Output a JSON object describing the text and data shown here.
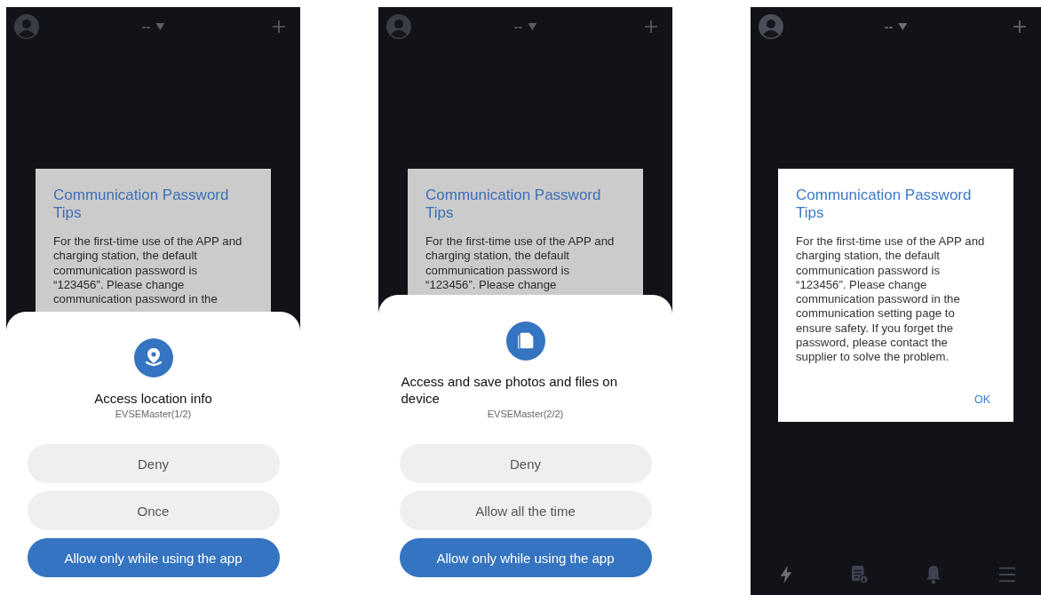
{
  "screens": [
    {
      "dimmed": true,
      "header": {
        "title": "--"
      },
      "dialog": {
        "title": "Communication Password Tips",
        "body_lines": [
          "For the first-time use of the APP and",
          "charging station, the default",
          "communication password is",
          "“123456”. Please change",
          "communication password in the"
        ]
      },
      "permission_sheet": {
        "kind": "location",
        "title": "Access location info",
        "subtitle": "EVSEMaster(1/2)",
        "buttons": [
          {
            "label": "Deny",
            "kind": "secondary"
          },
          {
            "label": "Once",
            "kind": "secondary"
          },
          {
            "label": "Allow only while using the app",
            "kind": "primary"
          }
        ]
      }
    },
    {
      "dimmed": true,
      "header": {
        "title": "--"
      },
      "dialog": {
        "title": "Communication Password Tips",
        "body_lines": [
          "For the first-time use of the APP and",
          "charging station, the default",
          "communication password is",
          "“123456”. Please change"
        ]
      },
      "permission_sheet": {
        "kind": "files",
        "title": "Access and save photos and files on device",
        "subtitle": "EVSEMaster(2/2)",
        "buttons": [
          {
            "label": "Deny",
            "kind": "secondary"
          },
          {
            "label": "Allow all the time",
            "kind": "secondary"
          },
          {
            "label": "Allow only while using the app",
            "kind": "primary"
          }
        ]
      }
    },
    {
      "dimmed": false,
      "header": {
        "title": "--"
      },
      "dialog": {
        "title": "Communication Password Tips",
        "body_lines": [
          "For the first-time use of the APP and",
          "charging station, the default",
          "communication password is",
          "“123456”. Please change",
          "communication password in the",
          "communication setting page to",
          "ensure safety. If you forget the",
          "password, please contact the",
          "supplier to solve the problem."
        ],
        "ok": "OK"
      },
      "nav": [
        {
          "kind": "bolt",
          "selected": true
        },
        {
          "kind": "document",
          "selected": false
        },
        {
          "kind": "bell",
          "selected": false
        },
        {
          "kind": "menu",
          "selected": false
        }
      ]
    }
  ]
}
